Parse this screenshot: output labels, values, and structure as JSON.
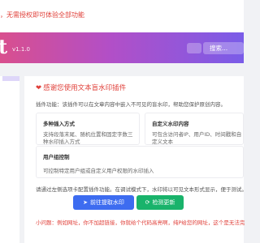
{
  "notice": {
    "text": "，无需授权即可体验全部功能"
  },
  "header": {
    "brand_glyph": "t",
    "version": "v1.1.0",
    "search_placeholder": "搜索..."
  },
  "card": {
    "title": "感谢您使用文本盲水印插件",
    "description": "插件功能：该插件可以在文章内容中嵌入不可见的盲水印，帮助您保护原创内容。",
    "features": [
      {
        "title": "多种插入方式",
        "lines": [
          "支持段落末尾、随机位置和固定字数三",
          "种水印插入方式"
        ]
      },
      {
        "title": "自定义水印内容",
        "lines": [
          "可包含访问者IP、用户ID、时间戳和自",
          "定义文本"
        ]
      },
      {
        "title": "用户组控制",
        "lines": [
          "可控制特定用户组或自定义用户权限的水印插入"
        ]
      }
    ],
    "hint": "请通过左侧选项卡配置插件功能。在调试模式下，水印将以可见文本形式显示，便于测试。",
    "buttons": {
      "settings": "前往提取水印",
      "update": "检测更新"
    },
    "warning": "小问题：例如网址，你不加超链接，你就给个代码高亮啊，纯P给您的网址，这个是无法完"
  },
  "colors": {
    "accent_red": "#e0403a",
    "header_gradient_start": "#d94f8e",
    "header_gradient_end": "#7a5ce8",
    "button_blue": "#3d6cf0",
    "button_green": "#19b36b"
  },
  "icons": {
    "title": "heart-icon",
    "settings_button": "cursor-icon",
    "update_button": "refresh-icon"
  }
}
